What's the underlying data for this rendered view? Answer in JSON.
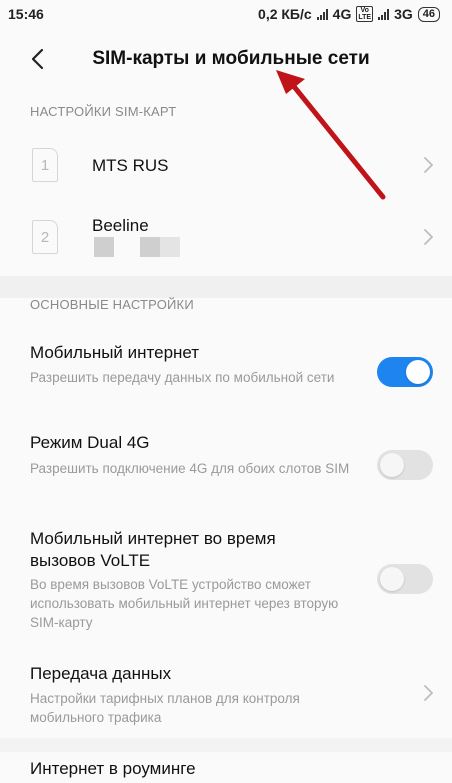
{
  "status_bar": {
    "time": "15:46",
    "speed": "0,2 КБ/с",
    "net1": "4G",
    "volte_top": "Vo",
    "volte_bottom": "LTE",
    "net2": "3G",
    "battery": "46"
  },
  "header": {
    "back_icon": "chevron-left-icon",
    "title": "SIM-карты и мобильные сети"
  },
  "sim_section": {
    "label": "НАСТРОЙКИ SIM-КАРТ",
    "cards": [
      {
        "slot": "1",
        "name": "MTS RUS"
      },
      {
        "slot": "2",
        "name": "Beeline"
      }
    ]
  },
  "main_section": {
    "label": "ОСНОВНЫЕ НАСТРОЙКИ",
    "items": [
      {
        "title": "Мобильный интернет",
        "desc": "Разрешить передачу данных по мобильной сети",
        "toggle": true
      },
      {
        "title": "Режим Dual 4G",
        "desc": "Разрешить подключение 4G для обоих слотов SIM",
        "toggle": false
      },
      {
        "title": "Мобильный интернет во время вызовов VoLTE",
        "desc": "Во время вызовов VoLTE устройство сможет использовать мобильный интернет через вторую SIM-карту",
        "toggle": false
      },
      {
        "title": "Передача данных",
        "desc": "Настройки тарифных планов для контроля мобильного трафика"
      },
      {
        "title": "Интернет в роуминге"
      }
    ]
  },
  "colors": {
    "accent": "#1d84f0",
    "annotation_arrow": "#c0141a"
  }
}
